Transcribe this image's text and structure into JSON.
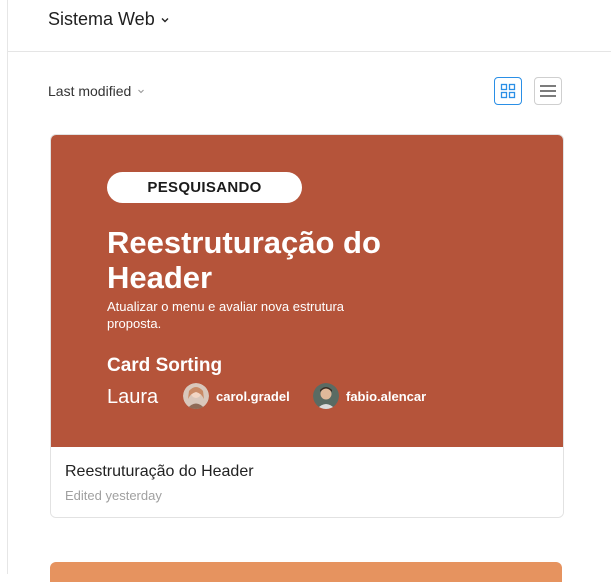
{
  "header": {
    "project_name": "Sistema Web"
  },
  "toolbar": {
    "sort_label": "Last modified",
    "view_mode": "grid"
  },
  "cards": [
    {
      "status": "PESQUISANDO",
      "cover_title": "Reestruturação do Header",
      "cover_description": "Atualizar o menu e avaliar nova estrutura proposta.",
      "method": "Card Sorting",
      "owner": "Laura",
      "members": [
        "carol.gradel",
        "fabio.alencar"
      ],
      "title": "Reestruturação do Header",
      "edited": "Edited yesterday",
      "cover_color": "#b5543a"
    },
    {
      "cover_color": "#e6935f"
    }
  ],
  "colors": {
    "accent": "#2a8fe6",
    "border": "#e2e2e2"
  }
}
